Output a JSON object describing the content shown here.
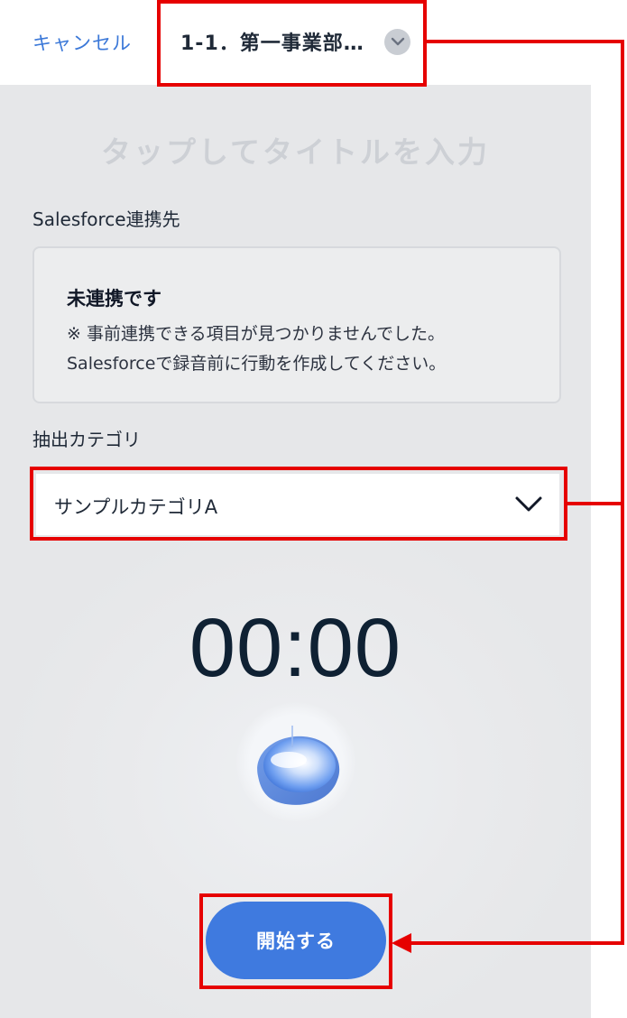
{
  "header": {
    "cancel_label": "キャンセル",
    "org_label": "1-1．第一事業部…",
    "chevron_icon": "chevron-down-icon"
  },
  "title_input": {
    "placeholder": "タップしてタイトルを入力"
  },
  "salesforce": {
    "label": "Salesforce連携先",
    "status": "未連携です",
    "note_line1": "※ 事前連携できる項目が見つかりませんでした。",
    "note_line2": "Salesforceで録音前に行動を作成してください。"
  },
  "category": {
    "label": "抽出カテゴリ",
    "selected": "サンプルカテゴリA"
  },
  "recorder": {
    "timer": "00:00",
    "start_label": "開始する"
  },
  "colors": {
    "accent": "#3f7adf",
    "link": "#3b78d8",
    "annotation": "#e60000",
    "timer_text": "#0f2133"
  }
}
